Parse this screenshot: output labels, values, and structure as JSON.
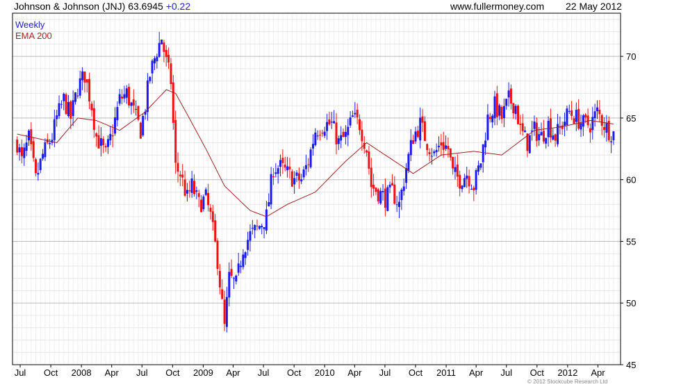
{
  "header": {
    "title": "Johnson & Johnson (JNJ) 63.6945",
    "change": "+0.22",
    "site": "www.fullermoney.com",
    "date": "22 May 2012"
  },
  "legend": {
    "weekly": "Weekly",
    "ema": "EMA 200"
  },
  "copyright": "© 2012 Stockcube Research Ltd",
  "colors": {
    "up": "#1a1aee",
    "down": "#ee1111",
    "ema": "#992222",
    "grid": "#d8d8d8"
  },
  "chart_data": {
    "type": "candlestick",
    "symbol": "JNJ",
    "interval": "weekly",
    "ylim": [
      45,
      73.5
    ],
    "yticks": [
      45,
      50,
      55,
      60,
      65,
      70
    ],
    "xticks": [
      "Jul",
      "Oct",
      "2008",
      "Apr",
      "Jul",
      "Oct",
      "2009",
      "Apr",
      "Jul",
      "Oct",
      "2010",
      "Apr",
      "Jul",
      "Oct",
      "2011",
      "Apr",
      "Jul",
      "Oct",
      "2012",
      "Apr"
    ],
    "grid": true,
    "close_path": [
      [
        "2007-06-22",
        63.0
      ],
      [
        "2007-07-06",
        61.5
      ],
      [
        "2007-07-27",
        63.3
      ],
      [
        "2007-08-17",
        60.0
      ],
      [
        "2007-09-07",
        62.0
      ],
      [
        "2007-10-05",
        63.5
      ],
      [
        "2007-10-19",
        65.0
      ],
      [
        "2007-11-09",
        66.5
      ],
      [
        "2007-11-30",
        65.0
      ],
      [
        "2007-12-21",
        67.5
      ],
      [
        "2008-01-11",
        68.5
      ],
      [
        "2008-02-01",
        66.0
      ],
      [
        "2008-02-15",
        63.5
      ],
      [
        "2008-03-14",
        62.0
      ],
      [
        "2008-04-04",
        64.0
      ],
      [
        "2008-04-25",
        66.5
      ],
      [
        "2008-05-16",
        67.0
      ],
      [
        "2008-06-06",
        65.5
      ],
      [
        "2008-06-27",
        64.0
      ],
      [
        "2008-07-11",
        66.0
      ],
      [
        "2008-07-25",
        68.5
      ],
      [
        "2008-08-15",
        70.5
      ],
      [
        "2008-08-29",
        71.5
      ],
      [
        "2008-09-12",
        69.5
      ],
      [
        "2008-09-26",
        68.0
      ],
      [
        "2008-10-10",
        61.0
      ],
      [
        "2008-10-24",
        60.5
      ],
      [
        "2008-11-14",
        58.5
      ],
      [
        "2008-11-28",
        59.5
      ],
      [
        "2008-12-19",
        58.0
      ],
      [
        "2009-01-09",
        58.5
      ],
      [
        "2009-01-23",
        57.0
      ],
      [
        "2009-02-13",
        53.5
      ],
      [
        "2009-03-06",
        48.0
      ],
      [
        "2009-03-20",
        52.0
      ],
      [
        "2009-04-10",
        51.5
      ],
      [
        "2009-05-01",
        54.5
      ],
      [
        "2009-05-22",
        55.5
      ],
      [
        "2009-06-12",
        56.0
      ],
      [
        "2009-07-10",
        57.0
      ],
      [
        "2009-07-31",
        61.0
      ],
      [
        "2009-08-21",
        61.0
      ],
      [
        "2009-09-11",
        60.5
      ],
      [
        "2009-10-02",
        60.0
      ],
      [
        "2009-10-23",
        60.0
      ],
      [
        "2009-11-13",
        61.5
      ],
      [
        "2009-12-04",
        64.0
      ],
      [
        "2010-01-01",
        64.5
      ],
      [
        "2010-01-22",
        64.5
      ],
      [
        "2010-02-12",
        63.0
      ],
      [
        "2010-03-05",
        63.5
      ],
      [
        "2010-03-26",
        65.0
      ],
      [
        "2010-04-16",
        64.5
      ],
      [
        "2010-05-07",
        62.5
      ],
      [
        "2010-05-21",
        59.5
      ],
      [
        "2010-06-11",
        59.0
      ],
      [
        "2010-07-02",
        58.5
      ],
      [
        "2010-07-23",
        59.0
      ],
      [
        "2010-08-13",
        58.0
      ],
      [
        "2010-09-03",
        61.0
      ],
      [
        "2010-09-24",
        63.5
      ],
      [
        "2010-10-15",
        64.5
      ],
      [
        "2010-11-05",
        63.0
      ],
      [
        "2010-11-26",
        62.0
      ],
      [
        "2010-12-17",
        63.0
      ],
      [
        "2011-01-07",
        62.5
      ],
      [
        "2011-01-21",
        60.5
      ],
      [
        "2011-02-11",
        60.0
      ],
      [
        "2011-03-04",
        60.5
      ],
      [
        "2011-03-25",
        59.5
      ],
      [
        "2011-04-15",
        61.5
      ],
      [
        "2011-05-06",
        65.0
      ],
      [
        "2011-05-27",
        66.0
      ],
      [
        "2011-06-17",
        65.0
      ],
      [
        "2011-07-08",
        66.5
      ],
      [
        "2011-07-29",
        66.0
      ],
      [
        "2011-08-12",
        64.0
      ],
      [
        "2011-09-02",
        63.0
      ],
      [
        "2011-09-23",
        64.0
      ],
      [
        "2011-10-14",
        63.5
      ],
      [
        "2011-11-04",
        64.5
      ],
      [
        "2011-11-25",
        63.5
      ],
      [
        "2011-12-16",
        64.5
      ],
      [
        "2012-01-06",
        65.5
      ],
      [
        "2012-01-27",
        65.0
      ],
      [
        "2012-02-17",
        64.5
      ],
      [
        "2012-03-09",
        64.5
      ],
      [
        "2012-03-30",
        65.5
      ],
      [
        "2012-04-20",
        64.5
      ],
      [
        "2012-05-04",
        64.0
      ],
      [
        "2012-05-22",
        63.7
      ]
    ],
    "ema_200": [
      [
        "2007-06-22",
        63.7
      ],
      [
        "2007-10-19",
        63.0
      ],
      [
        "2007-12-21",
        65.0
      ],
      [
        "2008-02-15",
        64.8
      ],
      [
        "2008-04-25",
        64.0
      ],
      [
        "2008-07-11",
        65.5
      ],
      [
        "2008-09-12",
        67.3
      ],
      [
        "2008-10-10",
        67.0
      ],
      [
        "2008-11-14",
        65.3
      ],
      [
        "2009-01-09",
        62.5
      ],
      [
        "2009-03-06",
        59.5
      ],
      [
        "2009-05-22",
        57.5
      ],
      [
        "2009-07-10",
        57.0
      ],
      [
        "2009-09-11",
        58.0
      ],
      [
        "2009-12-04",
        59.0
      ],
      [
        "2010-03-05",
        61.5
      ],
      [
        "2010-05-07",
        63.0
      ],
      [
        "2010-07-02",
        62.0
      ],
      [
        "2010-09-24",
        60.5
      ],
      [
        "2010-12-17",
        62.0
      ],
      [
        "2011-03-25",
        62.3
      ],
      [
        "2011-06-17",
        62.0
      ],
      [
        "2011-09-23",
        64.0
      ],
      [
        "2011-12-16",
        64.3
      ],
      [
        "2012-03-09",
        64.8
      ],
      [
        "2012-05-22",
        64.5
      ]
    ]
  }
}
